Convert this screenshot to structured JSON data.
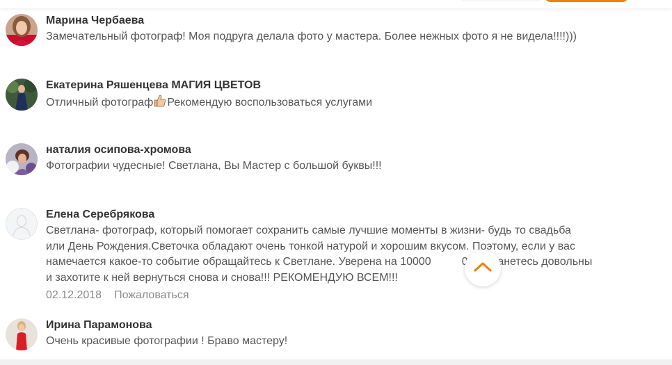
{
  "comments": [
    {
      "author": "Марина Чербаева",
      "lines": [
        "Замечательный фотограф! Моя подруга делала фото у мастера. Более нежных фото я не видела!!!!)))"
      ]
    },
    {
      "author": "Екатерина Ряшенцева МАГИЯ ЦВЕТОВ",
      "text_before": "Отличный фотограф",
      "text_after": "Рекомендую воспользоваться услугами"
    },
    {
      "author": "наталия осипова-хромова",
      "lines": [
        "Фотографии чудесные! Светлана, Вы Мастер с большой буквы!!!"
      ]
    },
    {
      "author": "Елена Серебрякова",
      "lines": [
        "Светлана- фотограф, который помогает сохранить самые лучшие моменты в жизни- будь то свадьба",
        "или День Рождения.Светочка обладают очень тонкой натурой и хорошим вкусом. Поэтому, если у вас",
        "намечается какое-то событие обращайтесь к Светлане. Уверена на 10000",
        "и захотите к ней вернуться снова и снова!!! РЕКОМЕНДУЮ ВСЕМ!!!"
      ],
      "line3_tail": "0% останетесь довольны",
      "date": "02.12.2018",
      "report_label": "Пожаловаться"
    },
    {
      "author": "Ирина Парамонова",
      "lines": [
        "Очень красивые фотографии ! Браво мастеру!"
      ]
    }
  ],
  "icons": {
    "thumb": "thumbs-up-icon",
    "scroll": "chevron-up-icon"
  },
  "colors": {
    "accent": "#ee8208",
    "author": "#333333",
    "text": "#555555",
    "meta": "#8a8a8a"
  }
}
